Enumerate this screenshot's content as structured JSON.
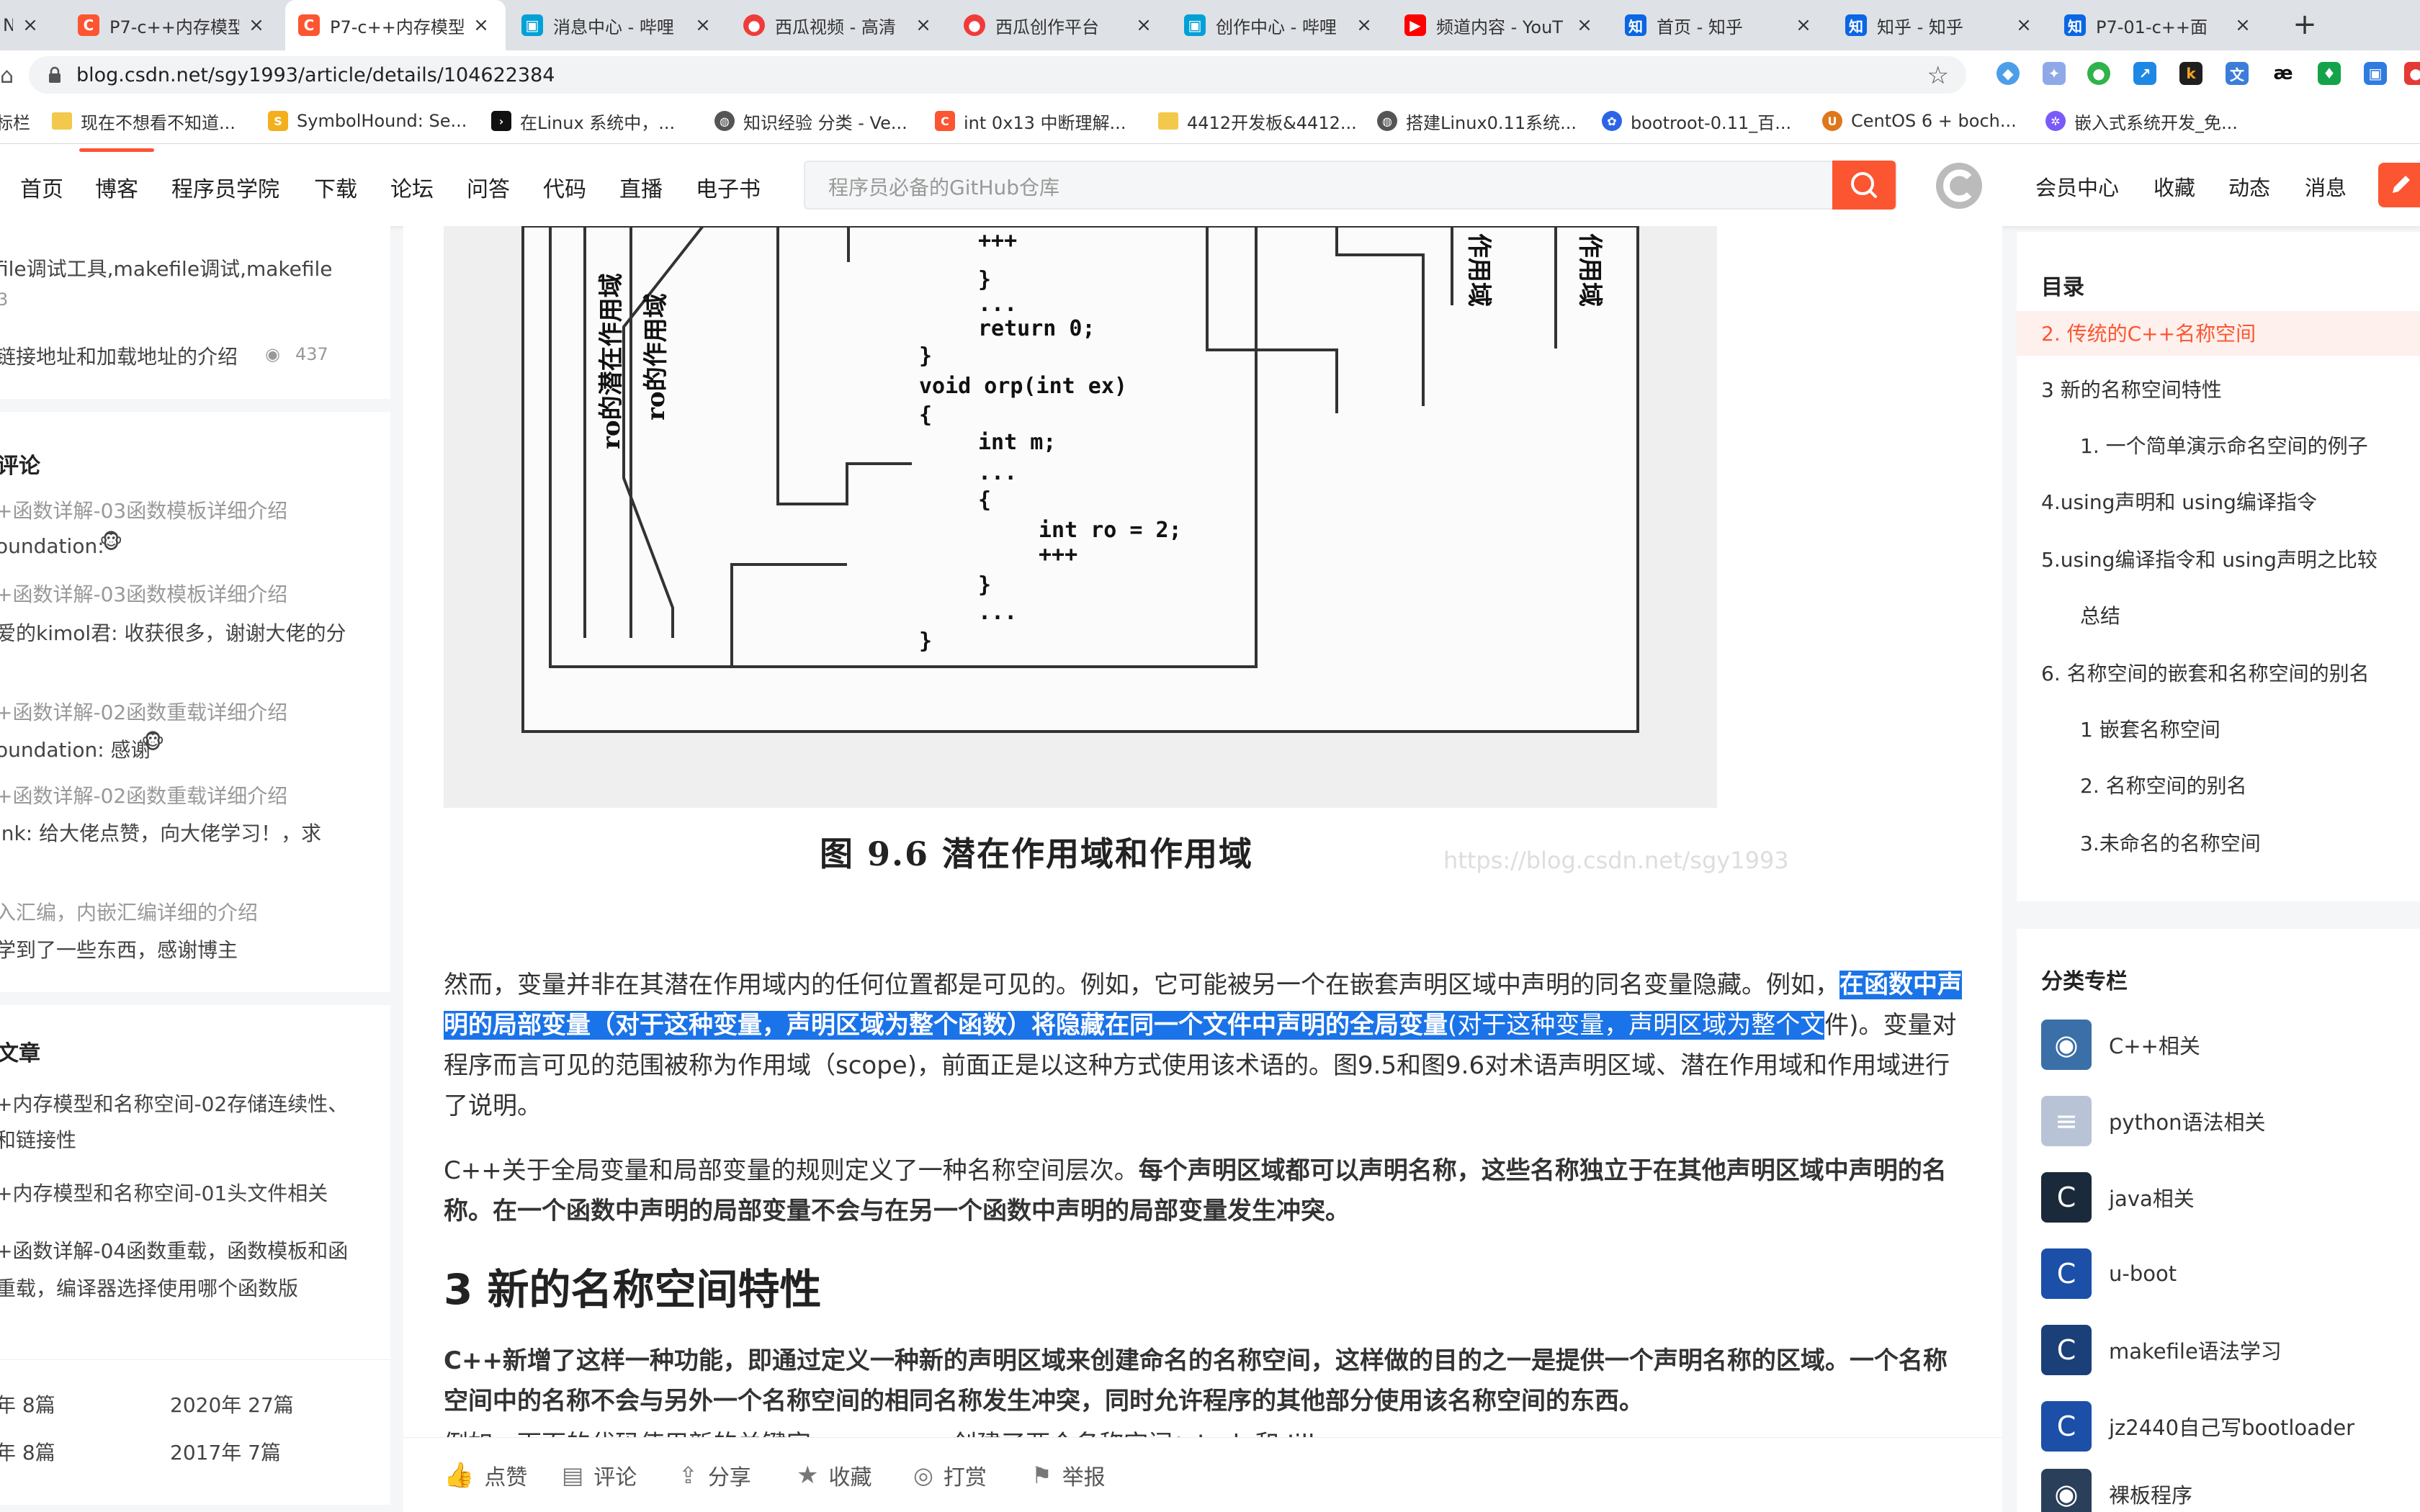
{
  "browser": {
    "tabs": [
      {
        "title": "N",
        "icon_color": "#1a73e8",
        "icon_glyph": "",
        "active": false
      },
      {
        "title": "P7-c++内存模型",
        "icon_color": "#fc5531",
        "icon_glyph": "C",
        "active": false
      },
      {
        "title": "P7-c++内存模型",
        "icon_color": "#fc5531",
        "icon_glyph": "C",
        "active": true
      },
      {
        "title": "消息中心 - 哔哩",
        "icon_color": "#00a1d6",
        "icon_glyph": "▣",
        "active": false
      },
      {
        "title": "西瓜视频 - 高清",
        "icon_color": "#f03b3b",
        "icon_glyph": "●",
        "active": false
      },
      {
        "title": "西瓜创作平台",
        "icon_color": "#f03b3b",
        "icon_glyph": "●",
        "active": false
      },
      {
        "title": "创作中心 - 哔哩",
        "icon_color": "#00a1d6",
        "icon_glyph": "▣",
        "active": false
      },
      {
        "title": "频道内容 - YouT",
        "icon_color": "#ff0000",
        "icon_glyph": "▶",
        "active": false
      },
      {
        "title": "首页 - 知乎",
        "icon_color": "#0a66e4",
        "icon_glyph": "知",
        "active": false
      },
      {
        "title": "知乎 - 知乎",
        "icon_color": "#0a66e4",
        "icon_glyph": "知",
        "active": false
      },
      {
        "title": "P7-01-c++面",
        "icon_color": "#0a66e4",
        "icon_glyph": "知",
        "active": false
      }
    ],
    "new_tab_label": "+",
    "close_glyph": "×",
    "url": "blog.csdn.net/sgy1993/article/details/104622384",
    "bookmarks": [
      {
        "label": "标栏",
        "icon": "none"
      },
      {
        "label": "现在不想看不知道...",
        "icon": "folder"
      },
      {
        "label": "SymbolHound: Se...",
        "icon": "symbolhound"
      },
      {
        "label": "在Linux 系统中，...",
        "icon": "terminal"
      },
      {
        "label": "知识经验 分类 - Ve...",
        "icon": "globe"
      },
      {
        "label": "int 0x13 中断理解...",
        "icon": "csdn"
      },
      {
        "label": "4412开发板&4412...",
        "icon": "folder"
      },
      {
        "label": "搭建Linux0.11系统...",
        "icon": "globe"
      },
      {
        "label": "bootroot-0.11_百...",
        "icon": "baidu"
      },
      {
        "label": "CentOS 6 + boch...",
        "icon": "ubuntu"
      },
      {
        "label": "嵌入式系统开发_免...",
        "icon": "gear"
      }
    ]
  },
  "site": {
    "nav": [
      "首页",
      "博客",
      "程序员学院",
      "下载",
      "论坛",
      "问答",
      "代码",
      "直播",
      "电子书"
    ],
    "search_placeholder": "程序员必备的GitHub仓库",
    "right_links": [
      "会员中心",
      "收藏",
      "动态",
      "消息"
    ],
    "accent": "#fc5531"
  },
  "left": {
    "recent": [
      {
        "line1": "file调试工具,makefile调试,makefile",
        "line2": "3"
      },
      {
        "line1": "链接地址和加载地址的介绍",
        "views": "437"
      }
    ],
    "comments_title": "评论",
    "comments": [
      {
        "article": "+函数详解-03函数模板详细介绍",
        "comment": "oundation:"
      },
      {
        "article": "+函数详解-03函数模板详细介绍",
        "comment": "爱的kimol君: 收获很多，谢谢大佬的分"
      },
      {
        "article": "+函数详解-02函数重载详细介绍",
        "comment": "oundation: 感谢"
      },
      {
        "article": "+函数详解-02函数重载详细介绍",
        "comment": "ink: 给大佬点赞，向大佬学习！，求"
      },
      {
        "article": "入汇编，内嵌汇编详细的介绍",
        "comment": "学到了一些东西，感谢博主"
      }
    ],
    "articles_title": "文章",
    "articles": [
      {
        "line1": "+内存模型和名称空间-02存储连续性、",
        "line2": "和链接性"
      },
      {
        "line1": "+内存模型和名称空间-01头文件相关",
        "line2": ""
      },
      {
        "line1": "+函数详解-04函数重载，函数模板和函",
        "line2": "重载，编译器选择使用哪个函数版"
      }
    ],
    "archive": [
      {
        "a": "年  8篇",
        "b": "2020年  27篇"
      },
      {
        "a": "年  8篇",
        "b": "2017年  7篇"
      }
    ]
  },
  "figure": {
    "code_lines": [
      "+++",
      "}",
      "...",
      "return 0;",
      "}",
      "void orp(int ex)",
      "{",
      "int m;",
      "...",
      "{",
      "int ro = 2;",
      "+++",
      "}",
      "...",
      "}"
    ],
    "vertical_labels": [
      "ro的潜在作用域",
      "ro的作用域",
      "作用域",
      "作用域"
    ],
    "caption": "图 9.6    潜在作用域和作用域",
    "watermark": "https://blog.csdn.net/sgy1993"
  },
  "article": {
    "p1_a": "然而，变量并非在其潜在作用域内的任何位置都是可见的。例如，它可能被另一个在嵌套声明区域中声明的同名变量隐藏。例如，",
    "p1_hl1": "在函数",
    "p1_hl2": "中声明的局部变量（对于这种变量，声明区域为整个函数）将隐藏在同一个文件中声明的全局变量",
    "p1_hl3": "(对于这种变量，声明区域为整个文",
    "p1_b": "件)。变量对程序而言可见的范围被称为作用域（scope)，前面正是以这种方式使用该术语的。图9.5和图9.6对术语声明区域、潜在作用域和作用域进行了说明。",
    "p2_a": "C++关于全局变量和局部变量的规则定义了一种名称空间层次。",
    "p2_b": "每个声明区域都可以声明名称，这些名称独立于在其他声明区域中声明的名称。在一个函数中声明的局部变量不会与在另一个函数中声明的局部变量发生冲突。",
    "heading": "3 新的名称空间特性",
    "p3": "C++新增了这样一种功能，即通过定义一种新的声明区域来创建命名的名称空间，这样做的目的之一是提供一个声明名称的区域。一个名称空间中的名称不会与另外一个名称空间的相同名称发生冲突，同时允许程序的其他部分使用该名称空间的东西。",
    "p4": "例如，下面的代码使用新的关键字namespace创建了两个名称空间：Jack 和 Jill。"
  },
  "actions": [
    "点赞",
    "评论",
    "分享",
    "收藏",
    "打赏",
    "举报"
  ],
  "toc": {
    "title": "目录",
    "items": [
      {
        "label": "2. 传统的C++名称空间",
        "level": 1,
        "active": true
      },
      {
        "label": "3 新的名称空间特性",
        "level": 1,
        "active": false
      },
      {
        "label": "1. 一个简单演示命名空间的例子",
        "level": 2,
        "active": false
      },
      {
        "label": "4.using声明和 using编译指令",
        "level": 1,
        "active": false
      },
      {
        "label": "5.using编译指令和 using声明之比较",
        "level": 1,
        "active": false
      },
      {
        "label": "总结",
        "level": 2,
        "active": false
      },
      {
        "label": "6. 名称空间的嵌套和名称空间的别名",
        "level": 1,
        "active": false
      },
      {
        "label": "1 嵌套名称空间",
        "level": 2,
        "active": false
      },
      {
        "label": "2. 名称空间的别名",
        "level": 2,
        "active": false
      },
      {
        "label": "3.未命名的名称空间",
        "level": 2,
        "active": false
      }
    ]
  },
  "columns": {
    "title": "分类专栏",
    "items": [
      {
        "label": "C++相关",
        "color": "#3b6fa8",
        "glyph": "◉"
      },
      {
        "label": "python语法相关",
        "color": "#b8c4d6",
        "glyph": "≡"
      },
      {
        "label": "java相关",
        "color": "#1b2a3a",
        "glyph": "C"
      },
      {
        "label": "u-boot",
        "color": "#1b4fa8",
        "glyph": "C"
      },
      {
        "label": "makefile语法学习",
        "color": "#1b3f78",
        "glyph": "C"
      },
      {
        "label": "jz2440自己写bootloader",
        "color": "#1b4fa8",
        "glyph": "C"
      },
      {
        "label": "裸板程序",
        "color": "#2a3f5a",
        "glyph": "◉"
      }
    ]
  }
}
